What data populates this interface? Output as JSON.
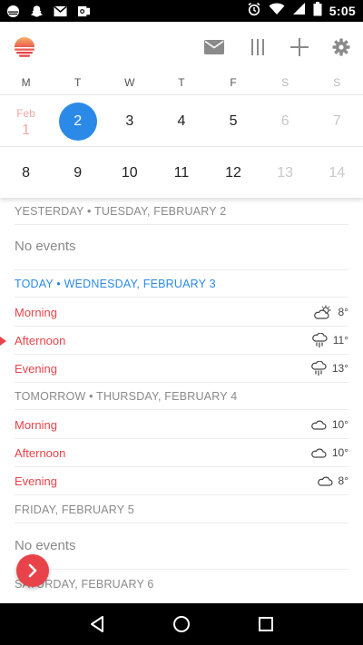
{
  "status_bar": {
    "time": "5:05",
    "left_icons": [
      "sunrise-notification-icon",
      "snapchat-icon",
      "gmail-icon",
      "outlook-icon"
    ],
    "right_icons": [
      "alarm-icon",
      "wifi-icon",
      "signal-icon",
      "battery-icon"
    ]
  },
  "header": {
    "logo": "sunrise-logo-icon",
    "actions": [
      "mail-icon",
      "columns-icon",
      "add-icon",
      "settings-icon"
    ]
  },
  "calendar": {
    "weekdays": [
      "M",
      "T",
      "W",
      "T",
      "F",
      "S",
      "S"
    ],
    "week1": [
      {
        "month": "Feb",
        "num": "1"
      },
      {
        "num": "2"
      },
      {
        "num": "3"
      },
      {
        "num": "4"
      },
      {
        "num": "5"
      },
      {
        "num": "6"
      },
      {
        "num": "7"
      }
    ],
    "week2": [
      "8",
      "9",
      "10",
      "11",
      "12",
      "13",
      "14"
    ]
  },
  "agenda": {
    "yesterday": {
      "header": "YESTERDAY • TUESDAY, FEBRUARY 2",
      "no_events": "No events"
    },
    "today": {
      "header": "TODAY • WEDNESDAY, FEBRUARY 3",
      "rows": [
        {
          "label": "Morning",
          "icon": "partly-cloudy-icon",
          "temp": "8°"
        },
        {
          "label": "Afternoon",
          "icon": "rain-icon",
          "temp": "11°"
        },
        {
          "label": "Evening",
          "icon": "rain-icon",
          "temp": "13°"
        }
      ]
    },
    "tomorrow": {
      "header": "TOMORROW • THURSDAY, FEBRUARY 4",
      "rows": [
        {
          "label": "Morning",
          "icon": "cloud-icon",
          "temp": "10°"
        },
        {
          "label": "Afternoon",
          "icon": "cloud-icon",
          "temp": "10°"
        },
        {
          "label": "Evening",
          "icon": "cloud-icon",
          "temp": "8°"
        }
      ]
    },
    "friday": {
      "header": "FRIDAY, FEBRUARY 5",
      "no_events": "No events"
    },
    "saturday": {
      "header": "SATURDAY, FEBRUARY 6"
    }
  },
  "fab": {
    "icon": "chevron-right-icon"
  },
  "nav": [
    "back-icon",
    "home-icon",
    "recents-icon"
  ],
  "colors": {
    "accent_red": "#e8434a",
    "today_blue": "#2b8ae8"
  }
}
